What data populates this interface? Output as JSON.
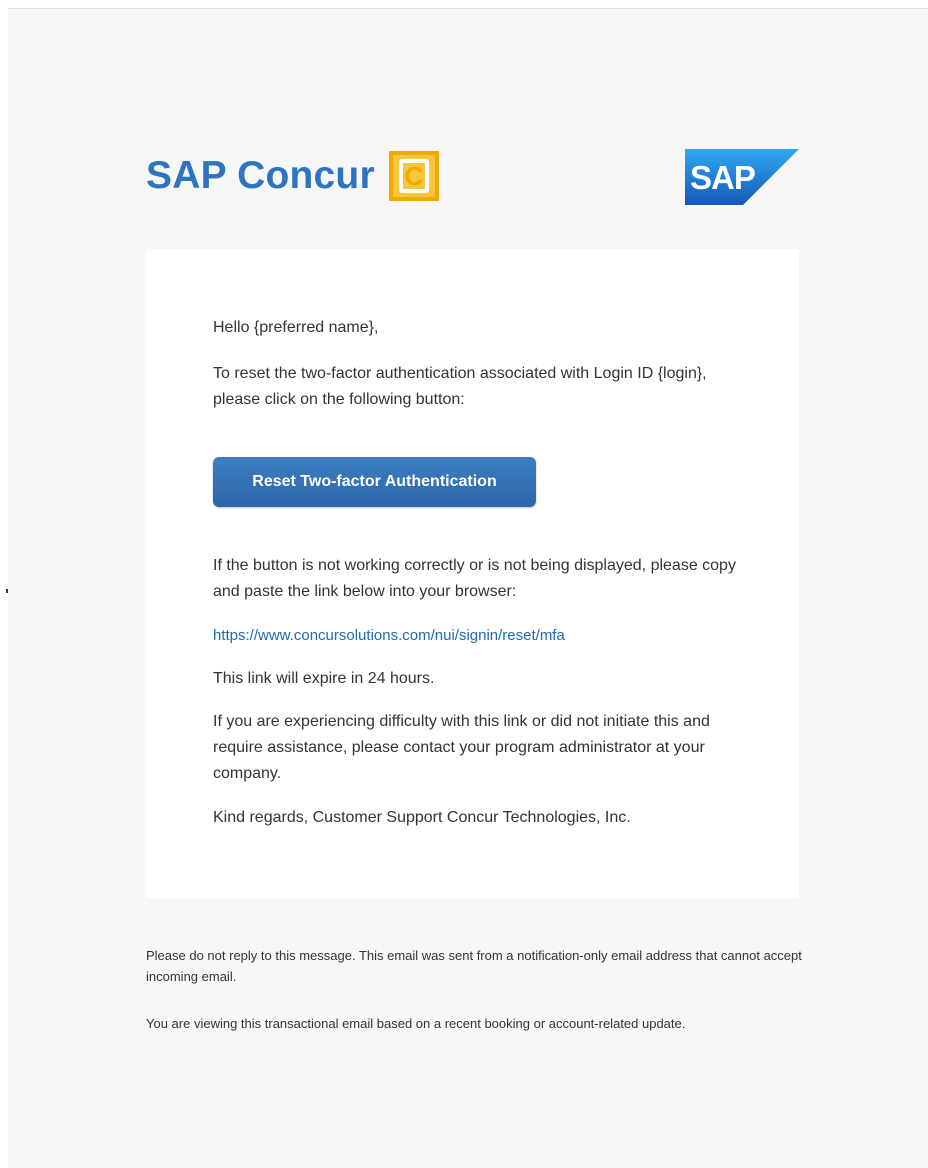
{
  "header": {
    "concur_wordmark": "SAP Concur",
    "concur_mark_letter": "C",
    "sap_logo_text": "SAP"
  },
  "body": {
    "greeting": "Hello {preferred name},",
    "intro": "To reset the two-factor authentication associated with Login ID {login}, please click on the following button:",
    "button_label": "Reset Two-factor Authentication",
    "not_working": "If the button is not working correctly or is not being displayed, please copy and paste the link below into your browser:",
    "link_text": "https://www.concursolutions.com/nui/signin/reset/mfa",
    "expire": "This link will expire in 24 hours.",
    "difficulty": "If you are experiencing difficulty with this link or did not initiate this and require assistance, please contact your program administrator at your company.",
    "regards": "Kind regards, Customer Support Concur Technologies, Inc."
  },
  "footer": {
    "no_reply": "Please do not reply to this message. This email was sent from a notification-only email address that cannot accept incoming email.",
    "transactional": "You are viewing this transactional email based on a recent booking or account-related update."
  },
  "colors": {
    "concur_blue": "#2f74c0",
    "concur_gold": "#f2a900",
    "button_blue": "#3572b6",
    "link_blue": "#1f69b5",
    "sap_blue": "#1b6fd0"
  }
}
